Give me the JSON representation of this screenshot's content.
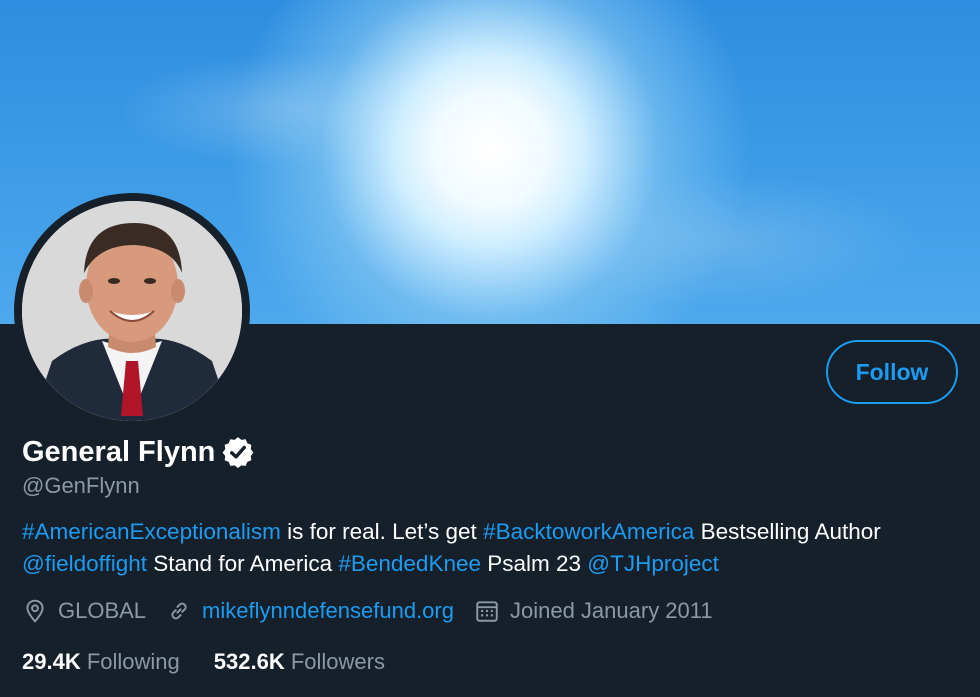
{
  "profile": {
    "name": "General Flynn",
    "handle": "@GenFlynn",
    "verified": true,
    "follow_label": "Follow"
  },
  "bio": {
    "parts": [
      {
        "text": "#AmericanExceptionalism",
        "link": true
      },
      {
        "text": " is for real. Let’s get ",
        "link": false
      },
      {
        "text": "#BacktoworkAmerica",
        "link": true
      },
      {
        "text": " Bestselling Author ",
        "link": false
      },
      {
        "text": "@fieldoffight",
        "link": true
      },
      {
        "text": " Stand for America ",
        "link": false
      },
      {
        "text": "#BendedKnee",
        "link": true
      },
      {
        "text": " Psalm 23 ",
        "link": false
      },
      {
        "text": "@TJHproject",
        "link": true
      }
    ]
  },
  "meta": {
    "location": "GLOBAL",
    "website": "mikeflynndefensefund.org",
    "joined": "Joined January 2011",
    "icons": [
      "location-pin-icon",
      "link-icon",
      "calendar-icon"
    ]
  },
  "stats": {
    "following_count": "29.4K",
    "following_label": "Following",
    "followers_count": "532.6K",
    "followers_label": "Followers"
  },
  "colors": {
    "background": "#15202b",
    "accent": "#1d9bf0",
    "secondary_text": "#8b98a5",
    "primary_text": "#ffffff"
  }
}
